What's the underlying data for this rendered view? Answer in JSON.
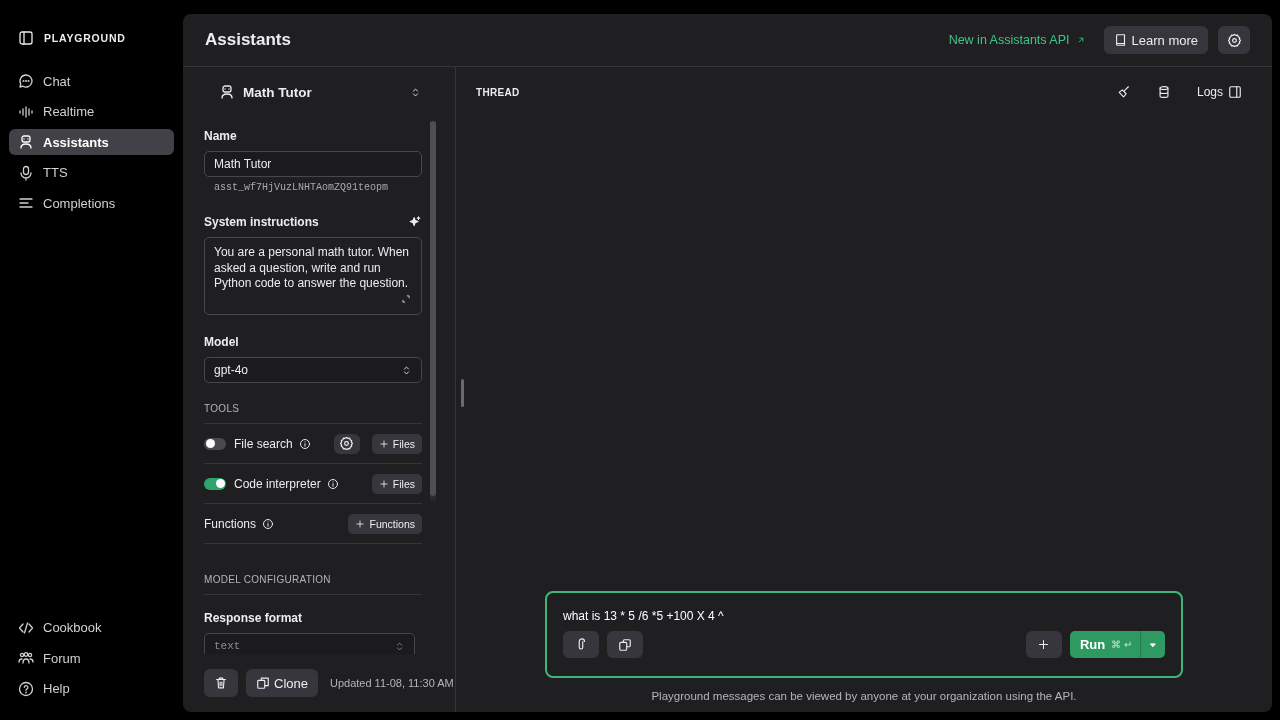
{
  "sidebar": {
    "title": "PLAYGROUND",
    "items": [
      {
        "label": "Chat",
        "selected": false
      },
      {
        "label": "Realtime",
        "selected": false
      },
      {
        "label": "Assistants",
        "selected": true
      },
      {
        "label": "TTS",
        "selected": false
      },
      {
        "label": "Completions",
        "selected": false
      }
    ],
    "footer_items": [
      {
        "label": "Cookbook"
      },
      {
        "label": "Forum"
      },
      {
        "label": "Help"
      }
    ]
  },
  "header": {
    "title": "Assistants",
    "news_link": "New in Assistants API",
    "learn_more": "Learn more"
  },
  "assistant": {
    "selector": "Math Tutor",
    "name_label": "Name",
    "name": "Math Tutor",
    "id": "asst_wf7HjVuzLNHTAomZQ91teopm",
    "instructions_label": "System instructions",
    "instructions": "You are a personal math tutor. When asked a question, write and run Python code to answer the question.",
    "model_label": "Model",
    "model": "gpt-4o",
    "tools_heading": "TOOLS",
    "tools": [
      {
        "kind": "toggle",
        "label": "File search",
        "on": false,
        "settings": true,
        "button": "Files"
      },
      {
        "kind": "toggle",
        "label": "Code interpreter",
        "on": true,
        "settings": false,
        "button": "Files"
      },
      {
        "kind": "plain",
        "label": "Functions",
        "settings": false,
        "button": "Functions"
      }
    ],
    "config_heading": "MODEL CONFIGURATION",
    "response_format_label": "Response format",
    "response_format": "text",
    "clone": "Clone",
    "updated": "Updated 11-08, 11:30 AM"
  },
  "thread": {
    "title": "THREAD",
    "logs": "Logs",
    "message": "what is 13 * 5 /6 *5 +100 X 4 ^",
    "run": "Run",
    "shortcut": "⌘ ↵",
    "disclaimer": "Playground messages can be viewed by anyone at your organization using the API."
  }
}
